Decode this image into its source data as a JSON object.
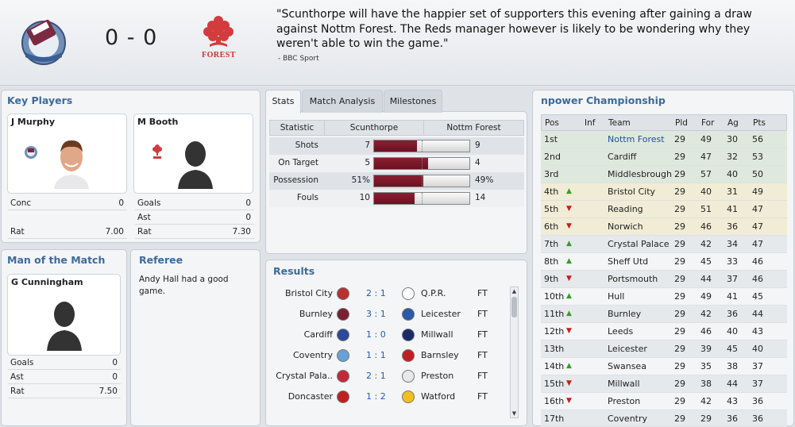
{
  "header": {
    "home_team": "Scunthorpe",
    "away_team": "Nottm Forest",
    "score": "0 - 0",
    "quote": "\"Scunthorpe will have the happier set of supporters this evening after gaining a draw against Nottm Forest. The Reds manager however is likely to be wondering why they weren't able to win the game.\"",
    "quote_source": "- BBC Sport",
    "away_crest_text": "FOREST"
  },
  "key_players": {
    "title": "Key Players",
    "home": {
      "name": "J Murphy",
      "rows": [
        {
          "label": "Conc",
          "value": "0"
        },
        {
          "label": "Rat",
          "value": "7.00"
        }
      ]
    },
    "away": {
      "name": "M Booth",
      "rows": [
        {
          "label": "Goals",
          "value": "0"
        },
        {
          "label": "Ast",
          "value": "0"
        },
        {
          "label": "Rat",
          "value": "7.30"
        }
      ]
    }
  },
  "motm": {
    "title": "Man of the Match",
    "name": "G Cunningham",
    "rows": [
      {
        "label": "Goals",
        "value": "0"
      },
      {
        "label": "Ast",
        "value": "0"
      },
      {
        "label": "Rat",
        "value": "7.50"
      }
    ]
  },
  "referee": {
    "title": "Referee",
    "text": "Andy Hall had a good game."
  },
  "tabs": [
    "Stats",
    "Match Analysis",
    "Milestones"
  ],
  "stats": {
    "headers": [
      "Statistic",
      "Scunthorpe",
      "Nottm Forest"
    ],
    "rows": [
      {
        "label": "Shots",
        "home": "7",
        "away": "9",
        "home_share": 0.44
      },
      {
        "label": "On Target",
        "home": "5",
        "away": "4",
        "home_share": 0.56
      },
      {
        "label": "Possession",
        "home": "51%",
        "away": "49%",
        "home_share": 0.51
      },
      {
        "label": "Fouls",
        "home": "10",
        "away": "14",
        "home_share": 0.42
      }
    ]
  },
  "results": {
    "title": "Results",
    "rows": [
      {
        "home": "Bristol City",
        "score": "2 : 1",
        "away": "Q.P.R.",
        "status": "FT",
        "hc": "#b83030",
        "ac": "#ffffff"
      },
      {
        "home": "Burnley",
        "score": "3 : 1",
        "away": "Leicester",
        "status": "FT",
        "hc": "#7a2030",
        "ac": "#2a5aa8"
      },
      {
        "home": "Cardiff",
        "score": "1 : 0",
        "away": "Millwall",
        "status": "FT",
        "hc": "#2a4a9a",
        "ac": "#1a2a6a"
      },
      {
        "home": "Coventry",
        "score": "1 : 1",
        "away": "Barnsley",
        "status": "FT",
        "hc": "#6aa0d8",
        "ac": "#c02020"
      },
      {
        "home": "Crystal Pala..",
        "score": "2 : 1",
        "away": "Preston",
        "status": "FT",
        "hc": "#c02a3a",
        "ac": "#e8e8e8"
      },
      {
        "home": "Doncaster",
        "score": "1 : 2",
        "away": "Watford",
        "status": "FT",
        "hc": "#c02020",
        "ac": "#f0c020"
      }
    ]
  },
  "league": {
    "title": "npower Championship",
    "headers": [
      "Pos",
      "Inf",
      "Team",
      "Pld",
      "For",
      "Ag",
      "Pts"
    ],
    "rows": [
      {
        "pos": "1st",
        "inf": "",
        "team": "Nottm Forest",
        "pld": "29",
        "for": "49",
        "ag": "30",
        "pts": "56",
        "zone": "promo",
        "highlight": true
      },
      {
        "pos": "2nd",
        "inf": "",
        "team": "Cardiff",
        "pld": "29",
        "for": "47",
        "ag": "32",
        "pts": "53",
        "zone": "promo"
      },
      {
        "pos": "3rd",
        "inf": "",
        "team": "Middlesbrough",
        "pld": "29",
        "for": "57",
        "ag": "40",
        "pts": "50",
        "zone": "promo"
      },
      {
        "pos": "4th",
        "inf": "up",
        "team": "Bristol City",
        "pld": "29",
        "for": "40",
        "ag": "31",
        "pts": "49",
        "zone": "playoff"
      },
      {
        "pos": "5th",
        "inf": "down",
        "team": "Reading",
        "pld": "29",
        "for": "51",
        "ag": "41",
        "pts": "47",
        "zone": "playoff"
      },
      {
        "pos": "6th",
        "inf": "down",
        "team": "Norwich",
        "pld": "29",
        "for": "46",
        "ag": "36",
        "pts": "47",
        "zone": "playoff"
      },
      {
        "pos": "7th",
        "inf": "up",
        "team": "Crystal Palace",
        "pld": "29",
        "for": "42",
        "ag": "34",
        "pts": "47",
        "zone": ""
      },
      {
        "pos": "8th",
        "inf": "up",
        "team": "Sheff Utd",
        "pld": "29",
        "for": "45",
        "ag": "33",
        "pts": "46",
        "zone": ""
      },
      {
        "pos": "9th",
        "inf": "down",
        "team": "Portsmouth",
        "pld": "29",
        "for": "44",
        "ag": "37",
        "pts": "46",
        "zone": ""
      },
      {
        "pos": "10th",
        "inf": "up",
        "team": "Hull",
        "pld": "29",
        "for": "49",
        "ag": "41",
        "pts": "45",
        "zone": ""
      },
      {
        "pos": "11th",
        "inf": "up",
        "team": "Burnley",
        "pld": "29",
        "for": "42",
        "ag": "36",
        "pts": "44",
        "zone": ""
      },
      {
        "pos": "12th",
        "inf": "down",
        "team": "Leeds",
        "pld": "29",
        "for": "46",
        "ag": "40",
        "pts": "43",
        "zone": ""
      },
      {
        "pos": "13th",
        "inf": "",
        "team": "Leicester",
        "pld": "29",
        "for": "39",
        "ag": "45",
        "pts": "40",
        "zone": ""
      },
      {
        "pos": "14th",
        "inf": "up",
        "team": "Swansea",
        "pld": "29",
        "for": "35",
        "ag": "38",
        "pts": "37",
        "zone": ""
      },
      {
        "pos": "15th",
        "inf": "down",
        "team": "Millwall",
        "pld": "29",
        "for": "38",
        "ag": "44",
        "pts": "37",
        "zone": ""
      },
      {
        "pos": "16th",
        "inf": "down",
        "team": "Preston",
        "pld": "29",
        "for": "42",
        "ag": "43",
        "pts": "36",
        "zone": ""
      },
      {
        "pos": "17th",
        "inf": "",
        "team": "Coventry",
        "pld": "29",
        "for": "29",
        "ag": "36",
        "pts": "36",
        "zone": ""
      }
    ]
  },
  "colors": {
    "accent": "#3d6a9a",
    "bar": "#7a1a2c",
    "promo": "#dfe8dc",
    "playoff": "#f1ecd6",
    "link": "#1f4f99"
  }
}
